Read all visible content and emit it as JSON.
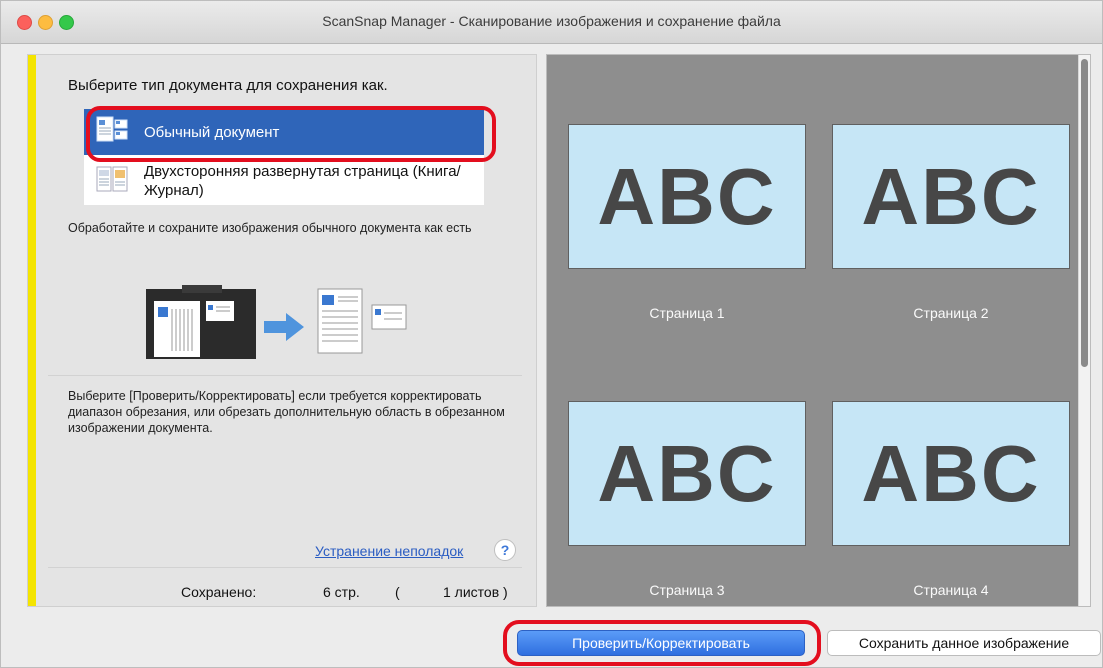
{
  "window": {
    "title": "ScanSnap Manager - Сканирование изображения и сохранение файла"
  },
  "left_panel": {
    "prompt": "Выберите тип документа для сохранения как.",
    "doc_types": [
      {
        "label": "Обычный документ",
        "selected": true,
        "icon": "normal-document-icon"
      },
      {
        "label": "Двухсторонняя развернутая страница (Книга/Журнал)",
        "selected": false,
        "icon": "book-spread-icon"
      }
    ],
    "description": "Обработайте и сохраните изображения обычного документа как есть",
    "hint": "Выберите [Проверить/Корректировать] если требуется корректировать диапазон обрезания, или обрезать дополнительную область в обрезанном изображении документа.",
    "help_link": "Устранение неполадок",
    "help_button": "?",
    "saved": {
      "label": "Сохранено:",
      "pages": "6 стр.",
      "paren_open": "(",
      "sheets": "1 листов )"
    }
  },
  "preview": {
    "pages": [
      {
        "text": "ABC",
        "caption": "Страница 1"
      },
      {
        "text": "ABC",
        "caption": "Страница 2"
      },
      {
        "text": "ABC",
        "caption": "Страница 3"
      },
      {
        "text": "ABC",
        "caption": "Страница 4"
      }
    ]
  },
  "buttons": {
    "check_correct": "Проверить/Корректировать",
    "save_image": "Сохранить данное изображение"
  },
  "colors": {
    "selection": "#2f65b9",
    "highlight_ring": "#e30e1e",
    "accent_bar": "#f4e400",
    "primary_button": "#2f6fe0"
  }
}
